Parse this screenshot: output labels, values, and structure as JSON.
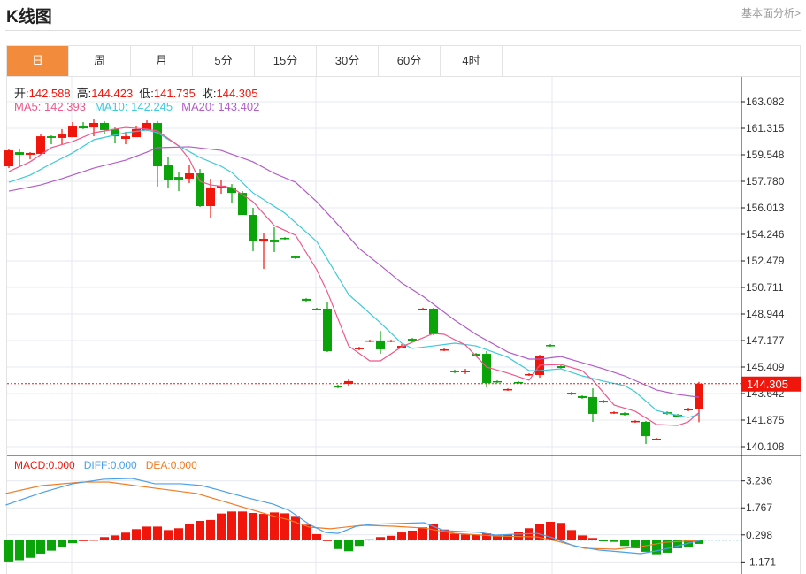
{
  "header": {
    "title": "K线图",
    "more_link": "基本面分析>"
  },
  "tabs": [
    {
      "label": "日",
      "active": true
    },
    {
      "label": "周"
    },
    {
      "label": "月"
    },
    {
      "label": "5分"
    },
    {
      "label": "15分"
    },
    {
      "label": "30分"
    },
    {
      "label": "60分"
    },
    {
      "label": "4时"
    }
  ],
  "legend": {
    "open_label": "开:",
    "open": "142.588",
    "high_label": "高:",
    "high": "144.423",
    "low_label": "低:",
    "low": "141.735",
    "close_label": "收:",
    "close": "144.305",
    "ma5": "MA5: 142.393",
    "ma10": "MA10: 142.245",
    "ma20": "MA20: 143.402"
  },
  "macd_legend": {
    "macd": "MACD:0.000",
    "diff": "DIFF:0.000",
    "dea": "DEA:0.000"
  },
  "colors": {
    "up": "#f0160c",
    "down": "#0aa40a",
    "ma5": "#f0588a",
    "ma10": "#3ccadc",
    "ma20": "#b35cc9",
    "diff": "#4aa0ea",
    "dea": "#f27a22",
    "active_tab": "#f28c3c"
  },
  "chart_data": [
    {
      "type": "candlestick",
      "title": "K线图",
      "current_price": "144.305",
      "ylim": [
        140.108,
        163.082
      ],
      "y_ticks": [
        "163.082",
        "161.315",
        "159.548",
        "157.780",
        "156.013",
        "154.246",
        "152.479",
        "150.711",
        "148.944",
        "147.177",
        "145.409",
        "143.642",
        "141.875",
        "140.108"
      ],
      "ohlc": [
        [
          158.78,
          159.84,
          159.96,
          158.66
        ],
        [
          159.72,
          159.55,
          159.96,
          158.78
        ],
        [
          159.55,
          159.67,
          159.72,
          159.25
        ],
        [
          159.61,
          160.78,
          160.9,
          159.55
        ],
        [
          160.78,
          160.67,
          160.84,
          160.25
        ],
        [
          160.67,
          160.9,
          161.26,
          160.25
        ],
        [
          160.72,
          161.43,
          161.73,
          160.72
        ],
        [
          161.43,
          161.31,
          161.73,
          161.26
        ],
        [
          161.37,
          161.67,
          161.96,
          160.78
        ],
        [
          161.67,
          161.2,
          161.79,
          160.9
        ],
        [
          161.26,
          160.78,
          161.37,
          160.31
        ],
        [
          160.61,
          160.78,
          161.08,
          160.25
        ],
        [
          160.72,
          161.26,
          161.49,
          160.72
        ],
        [
          161.2,
          161.67,
          161.84,
          161.14
        ],
        [
          161.67,
          158.78,
          161.79,
          157.43
        ],
        [
          158.84,
          157.84,
          159.43,
          157.37
        ],
        [
          158.07,
          157.9,
          158.43,
          157.13
        ],
        [
          157.96,
          158.31,
          158.84,
          157.66
        ],
        [
          158.31,
          156.13,
          158.6,
          156.07
        ],
        [
          156.13,
          157.37,
          157.96,
          155.36
        ],
        [
          157.31,
          157.49,
          157.84,
          156.96
        ],
        [
          157.37,
          157.01,
          157.6,
          156.31
        ],
        [
          157.01,
          155.54,
          157.13,
          155.54
        ],
        [
          155.54,
          153.83,
          156.01,
          153.13
        ],
        [
          153.77,
          153.95,
          154.3,
          151.95
        ],
        [
          153.89,
          153.72,
          154.72,
          153.07
        ],
        [
          154.01,
          153.95,
          154.07,
          153.89
        ],
        [
          152.77,
          152.66,
          152.83,
          152.6
        ],
        [
          149.95,
          149.83,
          150.0,
          149.77
        ],
        [
          149.3,
          149.24,
          149.36,
          149.18
        ],
        [
          149.3,
          146.47,
          149.77,
          146.41
        ],
        [
          144.17,
          144.05,
          144.23,
          143.99
        ],
        [
          144.29,
          144.47,
          144.58,
          144.17
        ],
        [
          146.59,
          146.7,
          146.76,
          146.53
        ],
        [
          147.12,
          147.18,
          147.23,
          147.06
        ],
        [
          147.18,
          146.59,
          147.82,
          146.29
        ],
        [
          147.12,
          147.18,
          147.23,
          147.06
        ],
        [
          146.7,
          146.82,
          146.94,
          146.65
        ],
        [
          147.29,
          147.12,
          147.35,
          147.06
        ],
        [
          149.24,
          149.3,
          149.36,
          149.18
        ],
        [
          149.3,
          147.59,
          149.36,
          147.53
        ],
        [
          146.53,
          146.59,
          146.65,
          146.47
        ],
        [
          145.17,
          145.06,
          145.23,
          145.0
        ],
        [
          145.06,
          145.17,
          145.29,
          144.94
        ],
        [
          146.29,
          146.17,
          146.35,
          146.11
        ],
        [
          146.29,
          144.35,
          146.47,
          144.05
        ],
        [
          144.47,
          144.41,
          144.52,
          144.35
        ],
        [
          143.88,
          143.94,
          143.99,
          143.82
        ],
        [
          144.41,
          144.35,
          144.47,
          144.29
        ],
        [
          144.88,
          144.94,
          145.0,
          144.82
        ],
        [
          144.88,
          146.17,
          146.23,
          144.7
        ],
        [
          146.88,
          146.82,
          146.94,
          146.76
        ],
        [
          145.47,
          145.35,
          145.53,
          145.29
        ],
        [
          143.7,
          143.58,
          143.76,
          143.52
        ],
        [
          143.47,
          143.35,
          143.52,
          143.29
        ],
        [
          143.41,
          142.29,
          143.99,
          141.76
        ],
        [
          143.17,
          143.05,
          143.23,
          142.99
        ],
        [
          142.34,
          142.4,
          142.46,
          142.29
        ],
        [
          142.34,
          142.23,
          142.4,
          142.17
        ],
        [
          141.76,
          141.82,
          141.87,
          141.7
        ],
        [
          141.76,
          140.81,
          141.82,
          140.28
        ],
        [
          140.58,
          140.64,
          140.7,
          140.52
        ],
        [
          142.4,
          142.29,
          142.46,
          142.23
        ],
        [
          142.23,
          142.11,
          142.29,
          142.05
        ],
        [
          142.52,
          142.64,
          142.7,
          142.46
        ],
        [
          142.588,
          144.305,
          144.423,
          141.735
        ]
      ],
      "ma5": [
        [
          0,
          158.43
        ],
        [
          2,
          159.08
        ],
        [
          4,
          160.02
        ],
        [
          6,
          160.43
        ],
        [
          8,
          161.02
        ],
        [
          11,
          161.37
        ],
        [
          13,
          161.26
        ],
        [
          14,
          161.14
        ],
        [
          16,
          160.14
        ],
        [
          17,
          159.25
        ],
        [
          18,
          157.78
        ],
        [
          19,
          157.54
        ],
        [
          21,
          157.37
        ],
        [
          23,
          156.42
        ],
        [
          25,
          154.83
        ],
        [
          27,
          154.19
        ],
        [
          29,
          151.89
        ],
        [
          30,
          150.42
        ],
        [
          32,
          146.82
        ],
        [
          34,
          145.82
        ],
        [
          35,
          145.82
        ],
        [
          37,
          146.76
        ],
        [
          40,
          147.65
        ],
        [
          41,
          147.59
        ],
        [
          43,
          146.88
        ],
        [
          45,
          145.41
        ],
        [
          47,
          145.0
        ],
        [
          49,
          144.53
        ],
        [
          50,
          145.53
        ],
        [
          52,
          145.58
        ],
        [
          54,
          145.17
        ],
        [
          55,
          144.53
        ],
        [
          57,
          142.88
        ],
        [
          59,
          142.46
        ],
        [
          61,
          141.58
        ],
        [
          63,
          141.52
        ],
        [
          64,
          141.76
        ],
        [
          65,
          142.39
        ]
      ],
      "ma10": [
        [
          0,
          157.72
        ],
        [
          2,
          158.19
        ],
        [
          4,
          158.96
        ],
        [
          6,
          159.67
        ],
        [
          8,
          160.55
        ],
        [
          11,
          161.02
        ],
        [
          13,
          161.2
        ],
        [
          14,
          161.02
        ],
        [
          16,
          160.14
        ],
        [
          18,
          159.37
        ],
        [
          20,
          158.78
        ],
        [
          21,
          158.37
        ],
        [
          23,
          157.01
        ],
        [
          26,
          155.66
        ],
        [
          29,
          153.77
        ],
        [
          32,
          150.24
        ],
        [
          35,
          148.35
        ],
        [
          37,
          147.0
        ],
        [
          38,
          146.65
        ],
        [
          40,
          146.82
        ],
        [
          42,
          147.0
        ],
        [
          44,
          146.82
        ],
        [
          47,
          146.06
        ],
        [
          49,
          145.17
        ],
        [
          50,
          145.17
        ],
        [
          52,
          145.29
        ],
        [
          54,
          144.82
        ],
        [
          56,
          144.47
        ],
        [
          58,
          144.17
        ],
        [
          59,
          143.76
        ],
        [
          61,
          142.52
        ],
        [
          62,
          142.34
        ],
        [
          64,
          142.05
        ],
        [
          65,
          142.25
        ]
      ],
      "ma20": [
        [
          0,
          157.13
        ],
        [
          3,
          157.54
        ],
        [
          5,
          157.96
        ],
        [
          8,
          158.66
        ],
        [
          11,
          159.19
        ],
        [
          13,
          159.72
        ],
        [
          14,
          160.02
        ],
        [
          17,
          160.08
        ],
        [
          20,
          159.84
        ],
        [
          23,
          159.08
        ],
        [
          25,
          158.31
        ],
        [
          27,
          157.72
        ],
        [
          29,
          156.42
        ],
        [
          31,
          154.89
        ],
        [
          33,
          153.3
        ],
        [
          35,
          152.18
        ],
        [
          37,
          151.01
        ],
        [
          39,
          150.12
        ],
        [
          42,
          148.53
        ],
        [
          44,
          147.59
        ],
        [
          47,
          146.41
        ],
        [
          49,
          145.94
        ],
        [
          50,
          145.94
        ],
        [
          52,
          146.11
        ],
        [
          54,
          145.7
        ],
        [
          56,
          145.29
        ],
        [
          58,
          144.82
        ],
        [
          61,
          143.88
        ],
        [
          63,
          143.58
        ],
        [
          65,
          143.4
        ]
      ]
    },
    {
      "type": "bar+line",
      "title": "MACD",
      "y_ticks": [
        "3.236",
        "1.767",
        "0.298",
        "-1.171"
      ],
      "macd_hist": [
        -1.15,
        -1.08,
        -0.95,
        -0.72,
        -0.56,
        -0.35,
        -0.15,
        0.0,
        0.02,
        0.18,
        0.27,
        0.42,
        0.61,
        0.75,
        0.75,
        0.56,
        0.66,
        0.88,
        1.06,
        1.11,
        1.46,
        1.57,
        1.57,
        1.49,
        1.44,
        1.52,
        1.47,
        1.33,
        0.85,
        0.34,
        0.0,
        -0.47,
        -0.59,
        -0.3,
        0.06,
        0.18,
        0.25,
        0.43,
        0.53,
        0.71,
        0.87,
        0.59,
        0.37,
        0.32,
        0.32,
        0.38,
        0.29,
        0.32,
        0.47,
        0.66,
        0.88,
        1.01,
        0.95,
        0.56,
        0.27,
        0.13,
        -0.05,
        -0.08,
        -0.3,
        -0.43,
        -0.62,
        -0.75,
        -0.67,
        -0.43,
        -0.37,
        -0.19
      ],
      "diff": [
        [
          -0.3,
          1.92
        ],
        [
          3.1,
          2.6
        ],
        [
          6,
          3.08
        ],
        [
          8.9,
          3.32
        ],
        [
          11.6,
          3.37
        ],
        [
          13.75,
          3.08
        ],
        [
          16.2,
          3.08
        ],
        [
          18.2,
          2.98
        ],
        [
          20.1,
          2.69
        ],
        [
          22.5,
          2.31
        ],
        [
          24.9,
          1.97
        ],
        [
          26.4,
          1.63
        ],
        [
          28.3,
          0.87
        ],
        [
          29.8,
          0.43
        ],
        [
          31,
          0.38
        ],
        [
          32.75,
          0.77
        ],
        [
          34.2,
          0.87
        ],
        [
          39.1,
          0.96
        ],
        [
          41,
          0.53
        ],
        [
          44.4,
          0.43
        ],
        [
          45.8,
          0.29
        ],
        [
          47.8,
          0.34
        ],
        [
          49.75,
          0.38
        ],
        [
          51.25,
          0.14
        ],
        [
          53.2,
          -0.29
        ],
        [
          55.6,
          -0.53
        ],
        [
          57.5,
          -0.62
        ],
        [
          59.5,
          -0.72
        ],
        [
          61.4,
          -0.53
        ],
        [
          63.4,
          -0.24
        ],
        [
          65.1,
          0
        ]
      ],
      "dea": [
        [
          -0.3,
          2.55
        ],
        [
          3.1,
          2.98
        ],
        [
          6.9,
          3.17
        ],
        [
          9.4,
          3.17
        ],
        [
          13.75,
          2.84
        ],
        [
          17.7,
          2.55
        ],
        [
          21.1,
          1.97
        ],
        [
          24.5,
          1.39
        ],
        [
          26.4,
          1.11
        ],
        [
          28.3,
          0.72
        ],
        [
          30.3,
          0.63
        ],
        [
          33.25,
          0.82
        ],
        [
          36.2,
          0.77
        ],
        [
          39.1,
          0.67
        ],
        [
          42,
          0.38
        ],
        [
          45.8,
          0.24
        ],
        [
          49.75,
          0.19
        ],
        [
          51.7,
          -0.05
        ],
        [
          54.2,
          -0.43
        ],
        [
          57.1,
          -0.48
        ],
        [
          59.5,
          -0.34
        ],
        [
          61.9,
          -0.1
        ],
        [
          65.1,
          0
        ]
      ]
    }
  ]
}
